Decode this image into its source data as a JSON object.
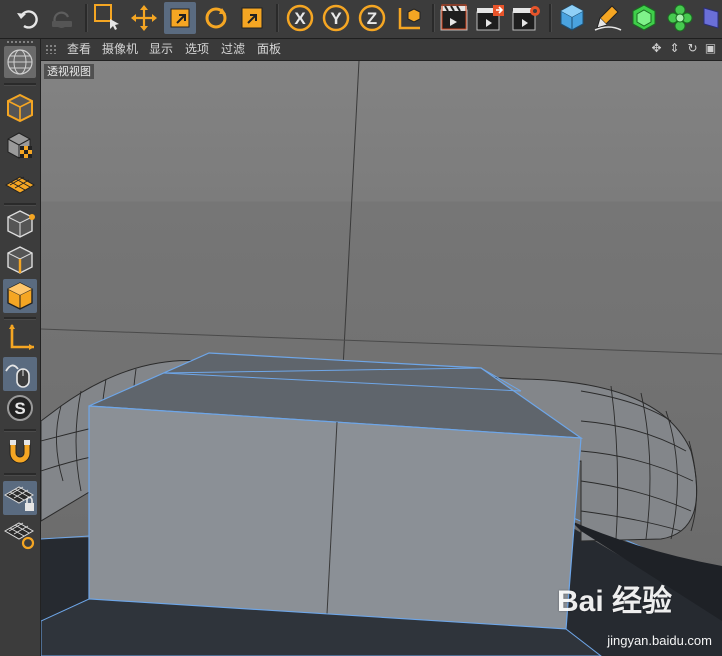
{
  "viewport": {
    "label": "透视视图",
    "menu": [
      "查看",
      "摄像机",
      "显示",
      "选项",
      "过滤",
      "面板"
    ]
  },
  "toolbar": {
    "buttons": [
      {
        "name": "undo-button",
        "icon": "undo-icon"
      },
      {
        "name": "redo-button",
        "icon": "redo-icon"
      },
      {
        "name": "live-selection-button",
        "icon": "selection-icon"
      },
      {
        "name": "move-button",
        "icon": "move-icon"
      },
      {
        "name": "scale-button",
        "icon": "scale-icon"
      },
      {
        "name": "rotate-button",
        "icon": "rotate-icon"
      },
      {
        "name": "last-tool-button",
        "icon": "tool-icon"
      },
      {
        "name": "x-axis-button",
        "label": "X"
      },
      {
        "name": "y-axis-button",
        "label": "Y"
      },
      {
        "name": "z-axis-button",
        "label": "Z"
      },
      {
        "name": "coordinate-system-button",
        "icon": "coordinate-icon"
      },
      {
        "name": "render-view-button",
        "icon": "clapper-icon"
      },
      {
        "name": "render-to-picture-viewer-button",
        "icon": "clapper-icon"
      },
      {
        "name": "render-settings-button",
        "icon": "clapper-gear-icon"
      },
      {
        "name": "cube-object-button",
        "icon": "cube-icon"
      },
      {
        "name": "pen-button",
        "icon": "pen-icon"
      },
      {
        "name": "subdivision-button",
        "icon": "subdivision-icon"
      },
      {
        "name": "cloner-button",
        "icon": "cloner-icon"
      },
      {
        "name": "deformer-button",
        "icon": "deformer-icon"
      }
    ],
    "accent": "#f5a623",
    "active_bg": "#5a6b80"
  },
  "sidebar": {
    "buttons": [
      {
        "name": "make-editable-button",
        "icon": "sphere-grid-icon"
      },
      {
        "name": "model-mode-button",
        "icon": "cube-icon"
      },
      {
        "name": "texture-mode-button",
        "icon": "checker-cube-icon"
      },
      {
        "name": "workplane-button",
        "icon": "grid-plane-icon"
      },
      {
        "name": "points-mode-button",
        "icon": "point-cube-icon"
      },
      {
        "name": "edges-mode-button",
        "icon": "edge-cube-icon"
      },
      {
        "name": "polygons-mode-button",
        "icon": "polygon-cube-icon"
      },
      {
        "name": "axis-mode-button",
        "icon": "axis-icon"
      },
      {
        "name": "tweak-mode-button",
        "icon": "mouse-icon"
      },
      {
        "name": "solo-button",
        "icon": "solo-icon"
      },
      {
        "name": "snapping-button",
        "icon": "magnet-icon"
      },
      {
        "name": "workplane-lock-button",
        "icon": "grid-lock-icon"
      },
      {
        "name": "workplane-rotate-button",
        "icon": "grid-rotate-icon"
      }
    ]
  },
  "watermark": {
    "logo": "Bai 经验",
    "url": "jingyan.baidu.com"
  }
}
